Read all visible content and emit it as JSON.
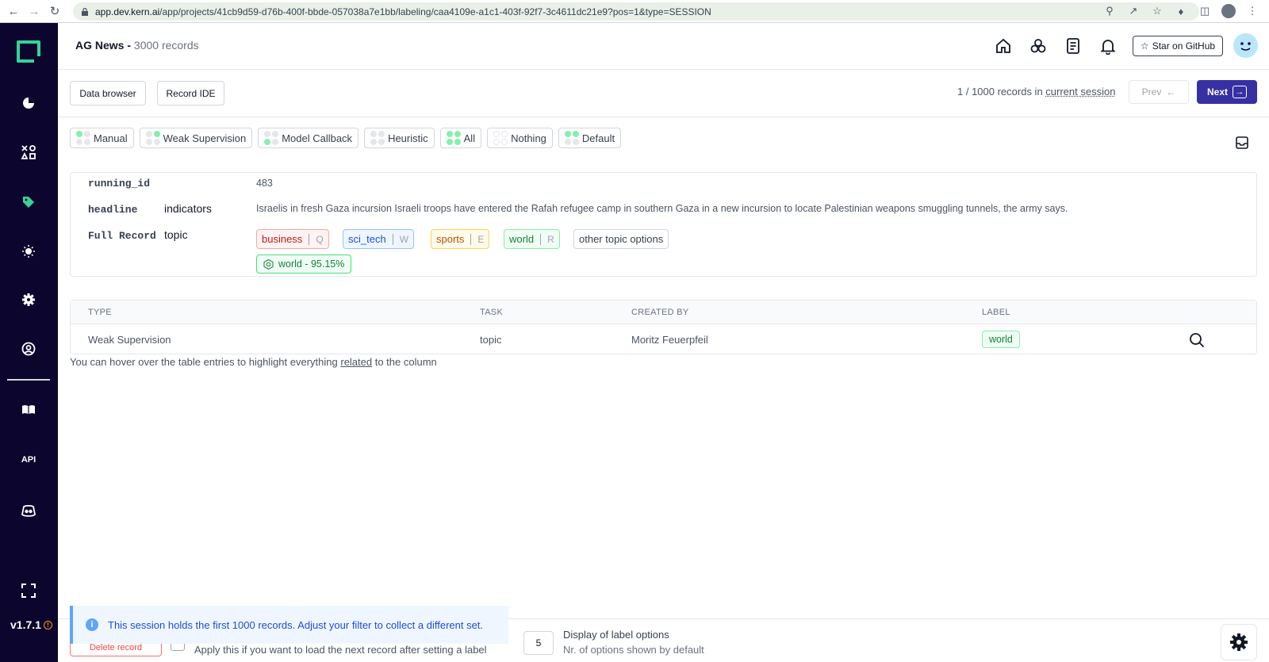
{
  "browser": {
    "url_host": "app.dev.kern.ai",
    "url_path": "/app/projects/41cb9d59-d76b-400f-bbde-057038a7e1bb/labeling/caa4109e-a1c1-403f-92f7-3c4611dc21e9?pos=1&type=SESSION"
  },
  "sidebar": {
    "icons": [
      "pie-chart-icon",
      "shapes-icon",
      "tag-icon",
      "lightbulb-icon",
      "gear-icon",
      "user-circle-icon",
      "book-icon",
      "api-icon",
      "discord-icon",
      "fullscreen-icon"
    ],
    "api_label": "API",
    "version": "v1.7.1"
  },
  "header": {
    "project_name": "AG News - ",
    "record_count": "3000 records",
    "github_label": "Star on GitHub"
  },
  "toolbar": {
    "data_browser_label": "Data browser",
    "record_ide_label": "Record IDE",
    "session_text": "1 / 1000 records in ",
    "session_link": "current session",
    "prev_label": "Prev",
    "next_label": "Next"
  },
  "filters": [
    {
      "label": "Manual",
      "dots": [
        "on",
        "off",
        "off",
        "off"
      ]
    },
    {
      "label": "Weak Supervision",
      "dots": [
        "off",
        "on",
        "off",
        "off"
      ]
    },
    {
      "label": "Model Callback",
      "dots": [
        "off",
        "off",
        "on",
        "off"
      ]
    },
    {
      "label": "Heuristic",
      "dots": [
        "off",
        "off",
        "off",
        "off"
      ]
    },
    {
      "label": "All",
      "dots": [
        "on",
        "on",
        "on",
        "on"
      ]
    },
    {
      "label": "Nothing",
      "dots": [
        "empty",
        "empty",
        "empty",
        "empty"
      ]
    },
    {
      "label": "Default",
      "dots": [
        "on",
        "on",
        "off",
        "off"
      ]
    }
  ],
  "record": {
    "running_id_key": "running_id",
    "running_id_value": "483",
    "headline_key": "headline",
    "headline_sub": "indicators",
    "headline_value": "Israelis in fresh Gaza incursion Israeli troops have entered the Rafah refugee camp in southern Gaza in a new incursion to locate Palestinian weapons smuggling tunnels, the army says.",
    "full_record_key": "Full Record",
    "full_record_sub": "topic",
    "labels": [
      {
        "name": "business",
        "key": "Q",
        "color": "red"
      },
      {
        "name": "sci_tech",
        "key": "W",
        "color": "blue"
      },
      {
        "name": "sports",
        "key": "E",
        "color": "yellow"
      },
      {
        "name": "world",
        "key": "R",
        "color": "green"
      }
    ],
    "other_options": "other topic options",
    "weak_supervision": "world - 95.15%"
  },
  "table": {
    "headers": [
      "TYPE",
      "TASK",
      "CREATED BY",
      "LABEL"
    ],
    "row": {
      "type": "Weak Supervision",
      "task": "topic",
      "created_by": "Moritz Feuerpfeil",
      "label": "world"
    }
  },
  "hint": {
    "before": "You can hover over the table entries to highlight everything ",
    "link": "related",
    "after": " to the column"
  },
  "bottom": {
    "delete_label": "Delete record",
    "auto_next_text": "Apply this if you want to load the next record after setting a label",
    "options_number": "5",
    "display_title": "Display of label options",
    "display_sub": "Nr. of options shown by default"
  },
  "toast": {
    "message": "This session holds the first 1000 records. Adjust your filter to collect a different set."
  },
  "colors": {
    "sidebar_bg": "#0c052e",
    "accent": "#3730a3",
    "logo": "#34d399"
  }
}
